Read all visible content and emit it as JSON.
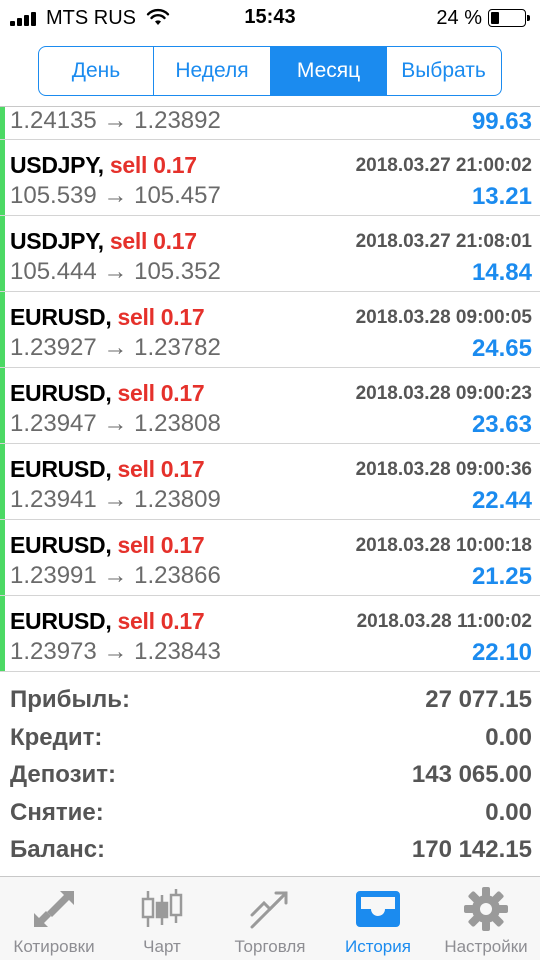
{
  "status_bar": {
    "carrier": "MTS RUS",
    "time": "15:43",
    "battery_percent": "24 %",
    "battery_level": 0.24
  },
  "period_tabs": [
    {
      "label": "День",
      "active": false
    },
    {
      "label": "Неделя",
      "active": false
    },
    {
      "label": "Месяц",
      "active": true
    },
    {
      "label": "Выбрать",
      "active": false
    }
  ],
  "orders_top_partial": {
    "prices": "1.24135 → 1.23892",
    "profit": "99.63"
  },
  "orders": [
    {
      "symbol": "USDJPY,",
      "action": "sell 0.17",
      "time": "2018.03.27 21:00:02",
      "prices": "105.539 → 105.457",
      "profit": "13.21"
    },
    {
      "symbol": "USDJPY,",
      "action": "sell 0.17",
      "time": "2018.03.27 21:08:01",
      "prices": "105.444 → 105.352",
      "profit": "14.84"
    },
    {
      "symbol": "EURUSD,",
      "action": "sell 0.17",
      "time": "2018.03.28 09:00:05",
      "prices": "1.23927 → 1.23782",
      "profit": "24.65"
    },
    {
      "symbol": "EURUSD,",
      "action": "sell 0.17",
      "time": "2018.03.28 09:00:23",
      "prices": "1.23947 → 1.23808",
      "profit": "23.63"
    },
    {
      "symbol": "EURUSD,",
      "action": "sell 0.17",
      "time": "2018.03.28 09:00:36",
      "prices": "1.23941 → 1.23809",
      "profit": "22.44"
    },
    {
      "symbol": "EURUSD,",
      "action": "sell 0.17",
      "time": "2018.03.28 10:00:18",
      "prices": "1.23991 → 1.23866",
      "profit": "21.25"
    },
    {
      "symbol": "EURUSD,",
      "action": "sell 0.17",
      "time": "2018.03.28 11:00:02",
      "prices": "1.23973 → 1.23843",
      "profit": "22.10"
    }
  ],
  "summary": [
    {
      "label": "Прибыль:",
      "value": "27 077.15"
    },
    {
      "label": "Кредит:",
      "value": "0.00"
    },
    {
      "label": "Депозит:",
      "value": "143 065.00"
    },
    {
      "label": "Снятие:",
      "value": "0.00"
    },
    {
      "label": "Баланс:",
      "value": "170 142.15"
    }
  ],
  "tab_bar": [
    {
      "label": "Котировки",
      "icon": "quotes-arrows-icon",
      "active": false
    },
    {
      "label": "Чарт",
      "icon": "candlestick-chart-icon",
      "active": false
    },
    {
      "label": "Торговля",
      "icon": "trade-trend-icon",
      "active": false
    },
    {
      "label": "История",
      "icon": "history-tray-icon",
      "active": true
    },
    {
      "label": "Настройки",
      "icon": "gear-icon",
      "active": false
    }
  ],
  "colors": {
    "accent": "#1b8bef",
    "sell": "#e5312b",
    "profit": "#1b8bef",
    "row_marker": "#4cd964",
    "inactive_tab": "#8e8e93"
  }
}
